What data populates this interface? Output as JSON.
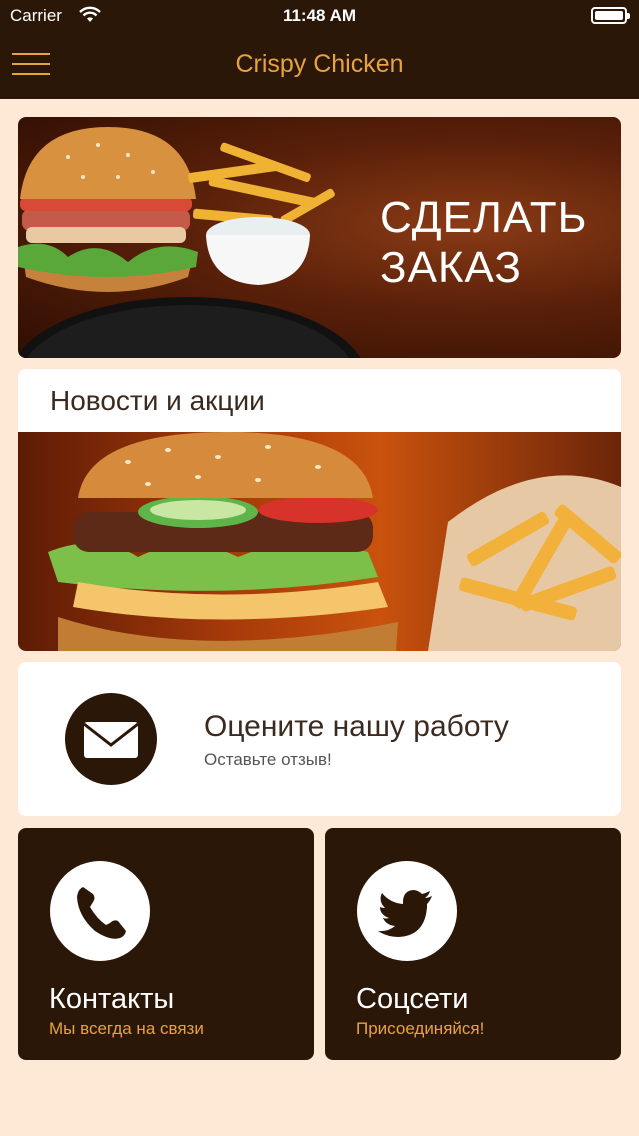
{
  "status_bar": {
    "carrier": "Carrier",
    "time": "11:48 AM"
  },
  "nav": {
    "title": "Crispy Chicken",
    "menu_icon": "hamburger-menu-icon"
  },
  "order_banner": {
    "line1": "СДЕЛАТЬ",
    "line2": "ЗАКАЗ"
  },
  "news_card": {
    "title": "Новости и акции"
  },
  "rate_card": {
    "title": "Оцените нашу работу",
    "subtitle": "Оставьте отзыв!",
    "icon": "envelope-icon"
  },
  "tiles": [
    {
      "title": "Контакты",
      "subtitle": "Мы всегда на связи",
      "icon": "phone-icon"
    },
    {
      "title": "Соцсети",
      "subtitle": "Присоединяйся!",
      "icon": "twitter-bird-icon"
    }
  ],
  "colors": {
    "brand_dark": "#2b1708",
    "accent": "#e7a33e",
    "background": "#fde9d6"
  }
}
